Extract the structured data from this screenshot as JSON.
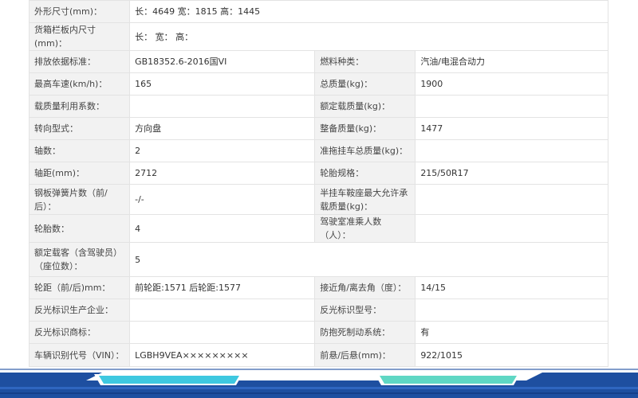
{
  "rows": [
    {
      "k1": "外形尺寸(mm)：",
      "v1": "长：4649 宽：1815 高：1445",
      "span": true
    },
    {
      "k1": "货箱栏板内尺寸(mm)：",
      "v1": "长：  宽：  高：",
      "span": true
    },
    {
      "k1": "排放依据标准：",
      "v1": "GB18352.6-2016国VI",
      "k2": "燃料种类：",
      "v2": "汽油/电混合动力"
    },
    {
      "k1": "最高车速(km/h)：",
      "v1": "165",
      "k2": "总质量(kg)：",
      "v2": "1900"
    },
    {
      "k1": "载质量利用系数：",
      "v1": "",
      "k2": "额定载质量(kg)：",
      "v2": ""
    },
    {
      "k1": "转向型式：",
      "v1": "方向盘",
      "k2": "整备质量(kg)：",
      "v2": "1477"
    },
    {
      "k1": "轴数：",
      "v1": "2",
      "k2": "准拖挂车总质量(kg)：",
      "v2": ""
    },
    {
      "k1": "轴距(mm)：",
      "v1": "2712",
      "k2": "轮胎规格：",
      "v2": "215/50R17"
    },
    {
      "k1": "钢板弹簧片数（前/后）：",
      "v1": "-/-",
      "k2": "半挂车鞍座最大允许承载质量(kg)：",
      "v2": ""
    },
    {
      "k1": "轮胎数：",
      "v1": "4",
      "k2": "驾驶室准乘人数（人）：",
      "v2": ""
    },
    {
      "k1": "额定载客（含驾驶员）（座位数）：",
      "v1": "5",
      "span": true
    },
    {
      "k1": "轮距（前/后)mm：",
      "v1": "前轮距:1571 后轮距:1577",
      "k2": "接近角/离去角（度）：",
      "v2": "14/15"
    },
    {
      "k1": "反光标识生产企业：",
      "v1": "",
      "k2": "反光标识型号：",
      "v2": ""
    },
    {
      "k1": "反光标识商标：",
      "v1": "",
      "k2": "防抱死制动系统：",
      "v2": "有"
    },
    {
      "k1": "车辆识别代号（VIN）：",
      "v1": "LGBH9VEA×××××××××",
      "k2": "前悬/后悬(mm)：",
      "v2": "922/1015"
    }
  ],
  "colors": {
    "label_bg": "#f2f2f2",
    "border": "#e3e3e3",
    "banner_dark": "#1e4fa0",
    "banner_cyan": "#3ec8e0",
    "banner_teal": "#5fd7c4"
  }
}
